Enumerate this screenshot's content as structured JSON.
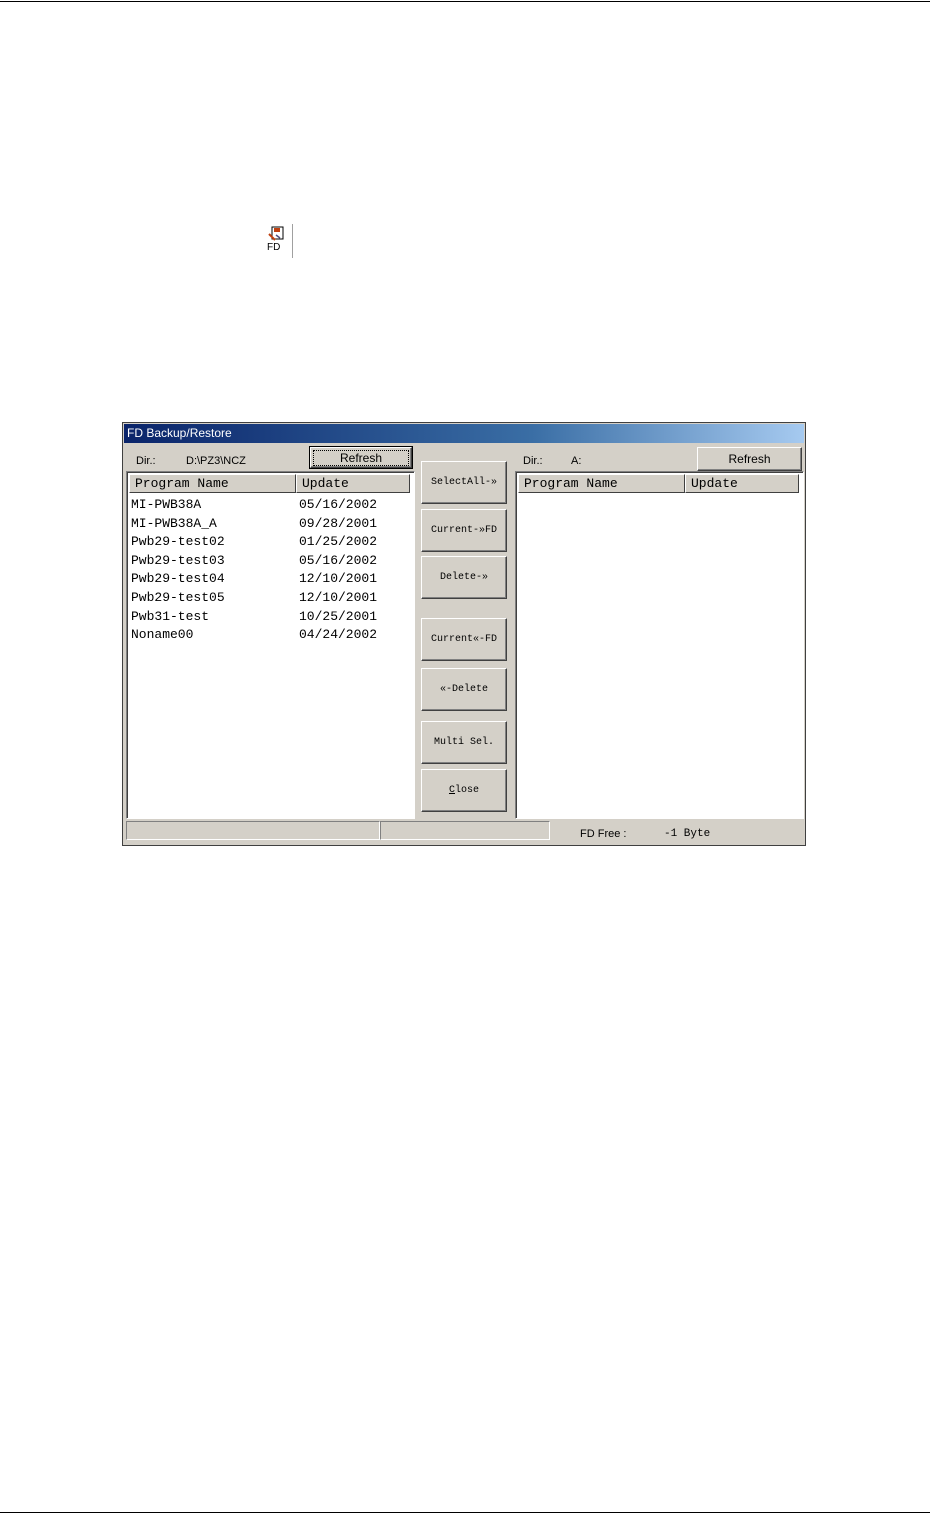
{
  "toolbar": {
    "fd_icon_label": "FD",
    "fd_icon": "floppy-disk-icon"
  },
  "window": {
    "title": "FD Backup/Restore"
  },
  "left": {
    "dir_label": "Dir.:",
    "dir_value": "D:\\PZ3\\NCZ",
    "refresh_label": "Refresh",
    "columns": [
      "Program Name",
      "Update"
    ],
    "rows": [
      [
        "MI-PWB38A",
        "05/16/2002"
      ],
      [
        "MI-PWB38A_A",
        "09/28/2001"
      ],
      [
        "Pwb29-test02",
        "01/25/2002"
      ],
      [
        "Pwb29-test03",
        "05/16/2002"
      ],
      [
        "Pwb29-test04",
        "12/10/2001"
      ],
      [
        "Pwb29-test05",
        "12/10/2001"
      ],
      [
        "Pwb31-test",
        "10/25/2001"
      ],
      [
        "Noname00",
        "04/24/2002"
      ]
    ]
  },
  "middle": {
    "select_all": "SelectAll-»",
    "current_to_fd": "Current-»FD",
    "delete_right": "Delete-»",
    "current_from_fd": "Current«-FD",
    "delete_left": "«-Delete",
    "multi_sel": "Multi Sel.",
    "close_accel": "C",
    "close_rest": "lose"
  },
  "right": {
    "dir_label": "Dir.:",
    "dir_value": "A:",
    "refresh_label": "Refresh",
    "columns": [
      "Program Name",
      "Update"
    ],
    "rows": []
  },
  "status": {
    "fd_free_label": "FD Free :",
    "fd_free_value": "-1 Byte"
  }
}
